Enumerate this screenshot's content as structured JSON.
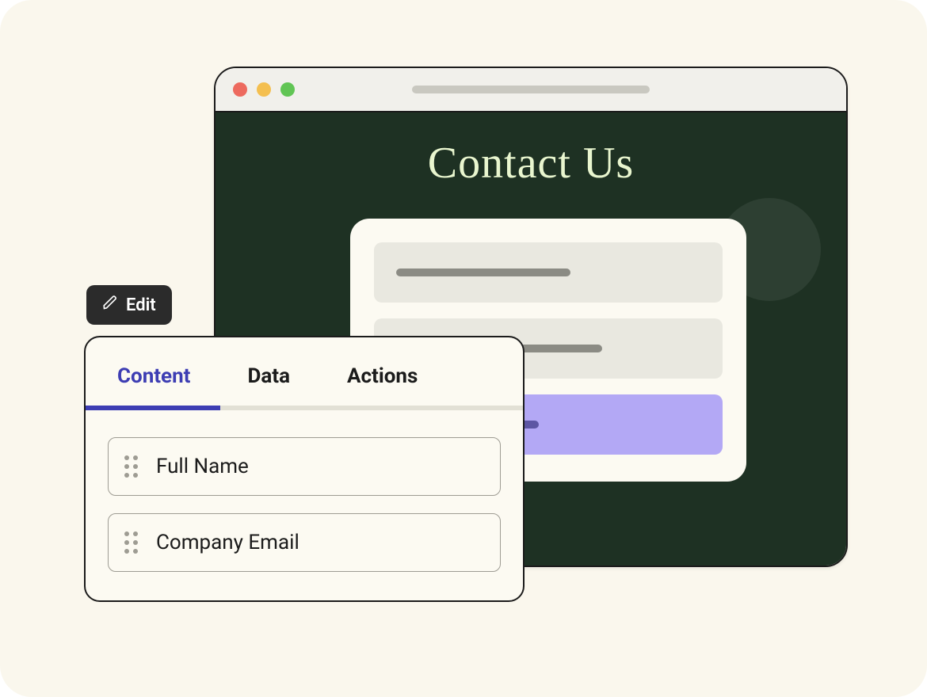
{
  "preview": {
    "heading": "Contact Us"
  },
  "edit_button": {
    "label": "Edit"
  },
  "panel": {
    "tabs": [
      {
        "label": "Content",
        "active": true
      },
      {
        "label": "Data",
        "active": false
      },
      {
        "label": "Actions",
        "active": false
      }
    ],
    "fields": [
      {
        "label": "Full Name"
      },
      {
        "label": "Company Email"
      }
    ]
  }
}
